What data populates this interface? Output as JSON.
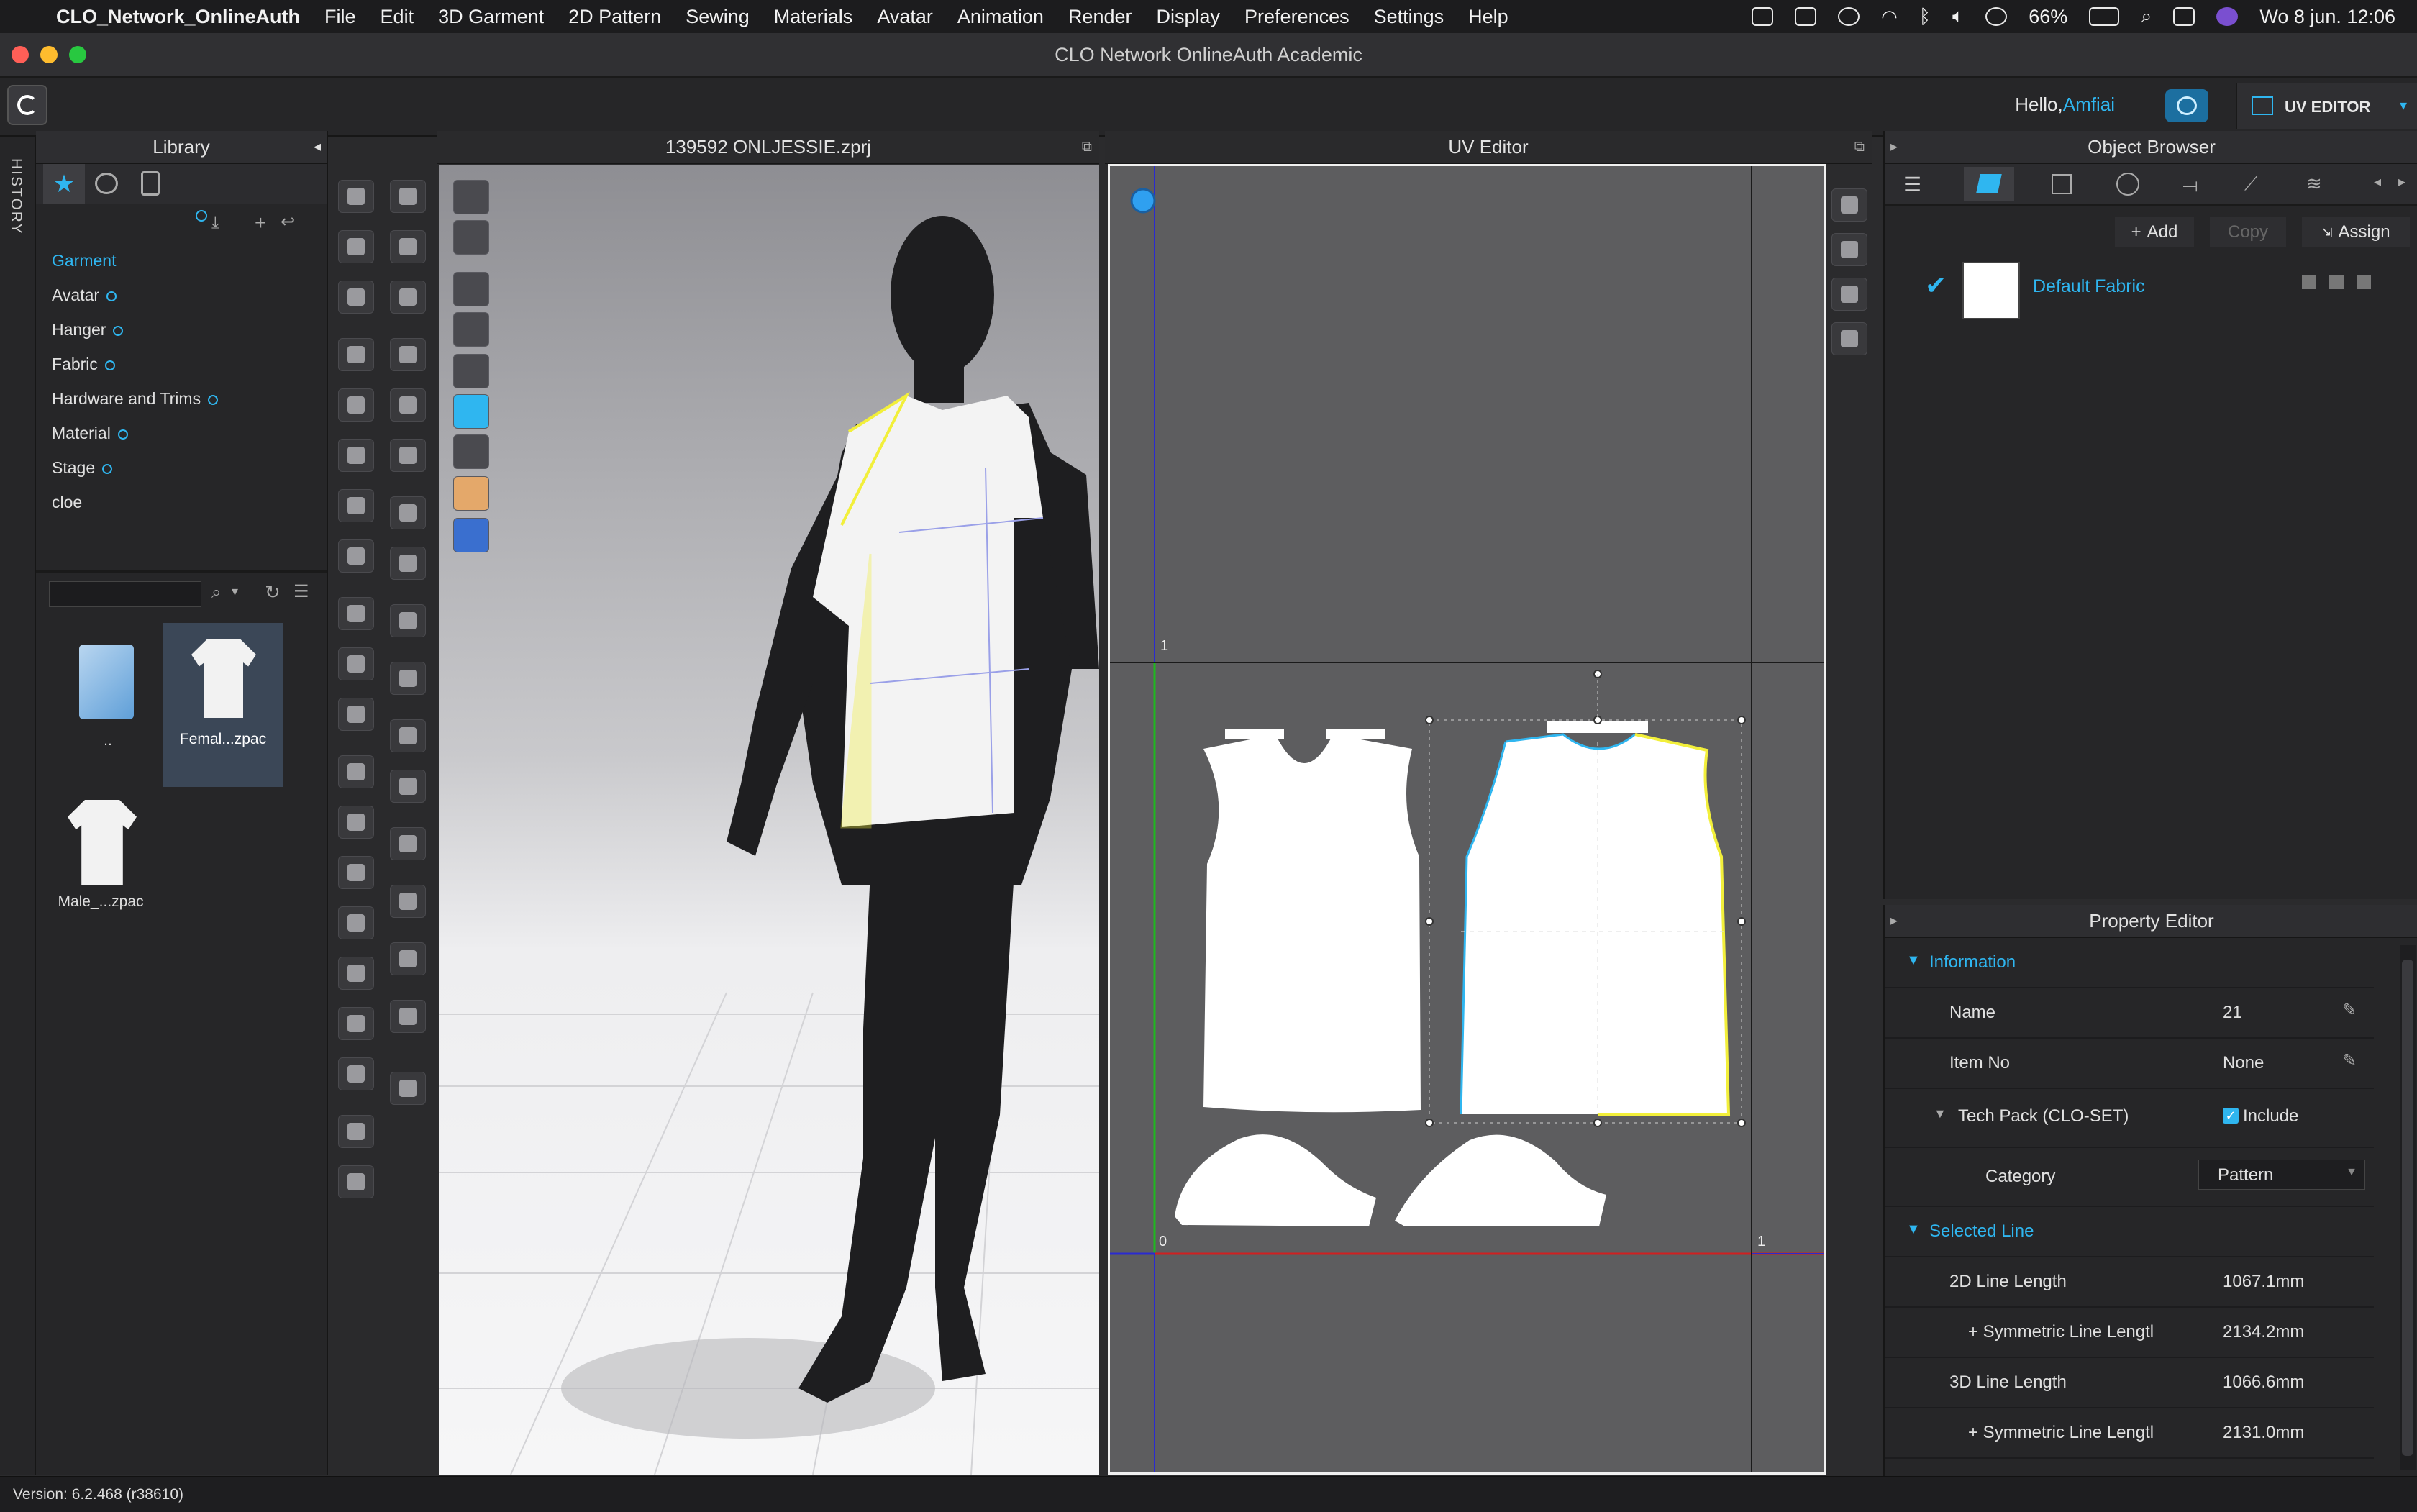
{
  "menubar": {
    "app": "CLO_Network_OnlineAuth",
    "items": [
      "File",
      "Edit",
      "3D Garment",
      "2D Pattern",
      "Sewing",
      "Materials",
      "Avatar",
      "Animation",
      "Render",
      "Display",
      "Preferences",
      "Settings",
      "Help"
    ],
    "battery": "66%",
    "datetime": "Wo 8 jun.  12:06"
  },
  "window": {
    "title": "CLO Network OnlineAuth Academic"
  },
  "topbar": {
    "hello": "Hello,",
    "user": "Amfiai",
    "mode": "UV EDITOR"
  },
  "history": {
    "label": "HISTORY"
  },
  "library": {
    "title": "Library",
    "items": [
      "Garment",
      "Avatar",
      "Hanger",
      "Fabric",
      "Hardware and Trims",
      "Material",
      "Stage",
      "cloe"
    ],
    "files": [
      "..",
      "Femal...zpac",
      "Male_...zpac"
    ]
  },
  "viewport3d": {
    "title": "139592 ONLJESSIE.zprj"
  },
  "uv": {
    "title": "UV Editor",
    "axis_one_top": "1",
    "axis_zero": "0",
    "axis_one_right": "1"
  },
  "object_browser": {
    "title": "Object Browser",
    "add": "Add",
    "copy": "Copy",
    "assign": "Assign",
    "fabric": "Default Fabric"
  },
  "property_editor": {
    "title": "Property Editor",
    "information": "Information",
    "name_label": "Name",
    "name_value": "21",
    "itemno_label": "Item No",
    "itemno_value": "None",
    "techpack_label": "Tech Pack (CLO-SET)",
    "techpack_value": "Include",
    "category_label": "Category",
    "category_value": "Pattern",
    "selected_line": "Selected Line",
    "l2d_label": "2D Line Length",
    "l2d_value": "1067.1mm",
    "sym1_label": "+ Symmetric Line Lengtl",
    "sym1_value": "2134.2mm",
    "l3d_label": "3D Line Length",
    "l3d_value": "1066.6mm",
    "sym2_label": "+ Symmetric Line Lengtl",
    "sym2_value": "2131.0mm"
  },
  "status": {
    "version": "Version: 6.2.468 (r38610)"
  },
  "colors": {
    "accent": "#2fb6f0",
    "panel": "#262628",
    "uv_bg": "#5d5d5f",
    "selection": "#f2ef3a"
  }
}
